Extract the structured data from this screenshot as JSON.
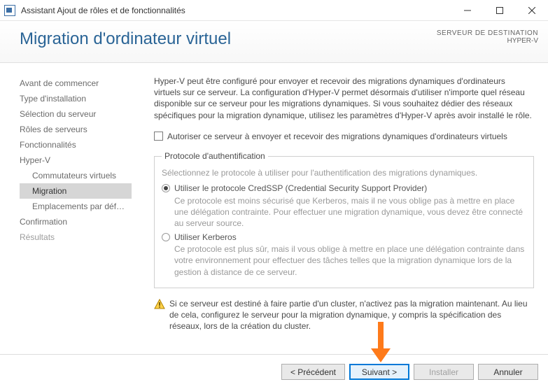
{
  "titlebar": {
    "title": "Assistant Ajout de rôles et de fonctionnalités"
  },
  "header": {
    "title": "Migration d'ordinateur virtuel",
    "dest_label": "SERVEUR DE DESTINATION",
    "dest_server": "HYPER-V"
  },
  "nav": {
    "items": [
      "Avant de commencer",
      "Type d'installation",
      "Sélection du serveur",
      "Rôles de serveurs",
      "Fonctionnalités",
      "Hyper-V"
    ],
    "sub": [
      "Commutateurs virtuels",
      "Migration",
      "Emplacements par déf…"
    ],
    "after": [
      "Confirmation",
      "Résultats"
    ]
  },
  "main": {
    "intro": "Hyper-V peut être configuré pour envoyer et recevoir des migrations dynamiques d'ordinateurs virtuels sur ce serveur. La configuration d'Hyper-V permet désormais d'utiliser n'importe quel réseau disponible sur ce serveur pour les migrations dynamiques. Si vous souhaitez dédier des réseaux spécifiques pour la migration dynamique, utilisez les paramètres d'Hyper-V après avoir installé le rôle.",
    "checkbox_label": "Autoriser ce serveur à envoyer et recevoir des migrations dynamiques d'ordinateurs virtuels",
    "legend": "Protocole d'authentification",
    "hint": "Sélectionnez le protocole à utiliser pour l'authentification des migrations dynamiques.",
    "opt1_label": "Utiliser le protocole CredSSP (Credential Security Support Provider)",
    "opt1_desc": "Ce protocole est moins sécurisé que Kerberos, mais il ne vous oblige pas à mettre en place une délégation contrainte. Pour effectuer une migration dynamique, vous devez être connecté au serveur source.",
    "opt2_label": "Utiliser Kerberos",
    "opt2_desc": "Ce protocole est plus sûr, mais il vous oblige à mettre en place une délégation contrainte dans votre environnement pour effectuer des tâches telles que la migration dynamique lors de la gestion à distance de ce serveur.",
    "note": "Si ce serveur est destiné à faire partie d'un cluster, n'activez pas la migration maintenant. Au lieu de cela, configurez le serveur pour la migration dynamique, y compris la spécification des réseaux, lors de la création du cluster."
  },
  "footer": {
    "prev": "< Précédent",
    "next": "Suivant >",
    "install": "Installer",
    "cancel": "Annuler"
  }
}
